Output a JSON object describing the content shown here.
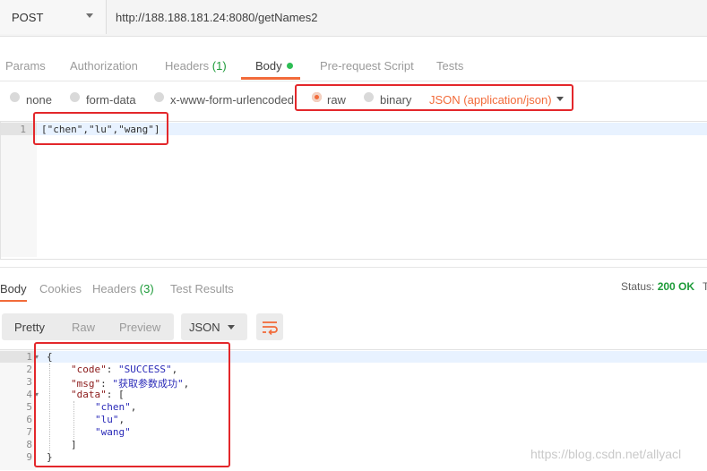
{
  "request": {
    "method": "POST",
    "url": "http://188.188.181.24:8080/getNames2"
  },
  "request_tabs": [
    {
      "label": "Params"
    },
    {
      "label": "Authorization"
    },
    {
      "label": "Headers",
      "count": "(1)"
    },
    {
      "label": "Body"
    },
    {
      "label": "Pre-request Script"
    },
    {
      "label": "Tests"
    }
  ],
  "body_types": {
    "none": "none",
    "form_data": "form-data",
    "urlencoded": "x-www-form-urlencoded",
    "raw": "raw",
    "binary": "binary",
    "selected": "raw",
    "content_type": "JSON (application/json)"
  },
  "request_body": {
    "line_number": "1",
    "text": "[\"chen\",\"lu\",\"wang\"]"
  },
  "response_tabs": [
    {
      "label": "Body"
    },
    {
      "label": "Cookies"
    },
    {
      "label": "Headers",
      "count": "(3)"
    },
    {
      "label": "Test Results"
    }
  ],
  "status": {
    "label": "Status:",
    "value": "200 OK",
    "cut_off": "T"
  },
  "view_modes": [
    "Pretty",
    "Raw",
    "Preview"
  ],
  "format": "JSON",
  "response_lines": [
    {
      "n": "1",
      "text": "{"
    },
    {
      "n": "2",
      "text": "\"code\": \"SUCCESS\","
    },
    {
      "n": "3",
      "text": "\"msg\": \"获取参数成功\","
    },
    {
      "n": "4",
      "text": "\"data\": ["
    },
    {
      "n": "5",
      "text": "\"chen\","
    },
    {
      "n": "6",
      "text": "\"lu\","
    },
    {
      "n": "7",
      "text": "\"wang\""
    },
    {
      "n": "8",
      "text": "]"
    },
    {
      "n": "9",
      "text": "}"
    }
  ],
  "response_json": {
    "code_key": "\"code\"",
    "code_val": "\"SUCCESS\"",
    "msg_key": "\"msg\"",
    "msg_val": "\"获取参数成功\"",
    "data_key": "\"data\"",
    "items": [
      "\"chen\"",
      "\"lu\"",
      "\"wang\""
    ]
  },
  "watermark": "https://blog.csdn.net/allyacl",
  "colors": {
    "accent": "#f26b3a",
    "success": "#1d9b39",
    "annotation": "#e3272b"
  }
}
